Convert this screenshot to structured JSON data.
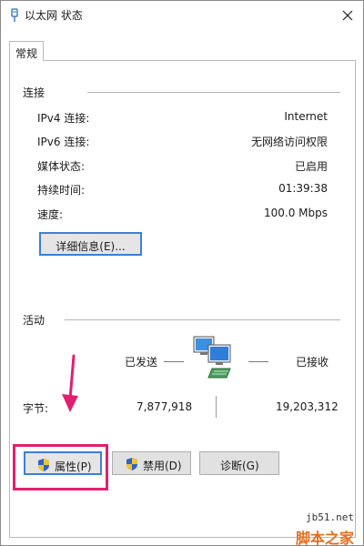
{
  "window": {
    "title": "以太网 状态",
    "close_glyph": "✕"
  },
  "tabs": [
    {
      "label": "常规",
      "active": true
    }
  ],
  "connection": {
    "section_label": "连接",
    "rows": [
      {
        "label": "IPv4 连接:",
        "value": "Internet"
      },
      {
        "label": "IPv6 连接:",
        "value": "无网络访问权限"
      },
      {
        "label": "媒体状态:",
        "value": "已启用"
      },
      {
        "label": "持续时间:",
        "value": "01:39:38"
      },
      {
        "label": "速度:",
        "value": "100.0 Mbps"
      }
    ],
    "details_button": "详细信息(E)..."
  },
  "activity": {
    "section_label": "活动",
    "sent_label": "已发送",
    "received_label": "已接收",
    "bytes_label": "字节:",
    "bytes_sent": "7,877,918",
    "bytes_received": "19,203,312",
    "network_icon": "network-computers-icon"
  },
  "buttons": {
    "properties": "属性(P)",
    "disable": "禁用(D)",
    "diagnose": "诊断(G)"
  },
  "colors": {
    "highlight": "#e0206f",
    "focus_border": "#3c7fd6",
    "watermark_orange": "#e07020"
  },
  "watermark": {
    "site": "jb51.net",
    "text": "脚本之家"
  }
}
